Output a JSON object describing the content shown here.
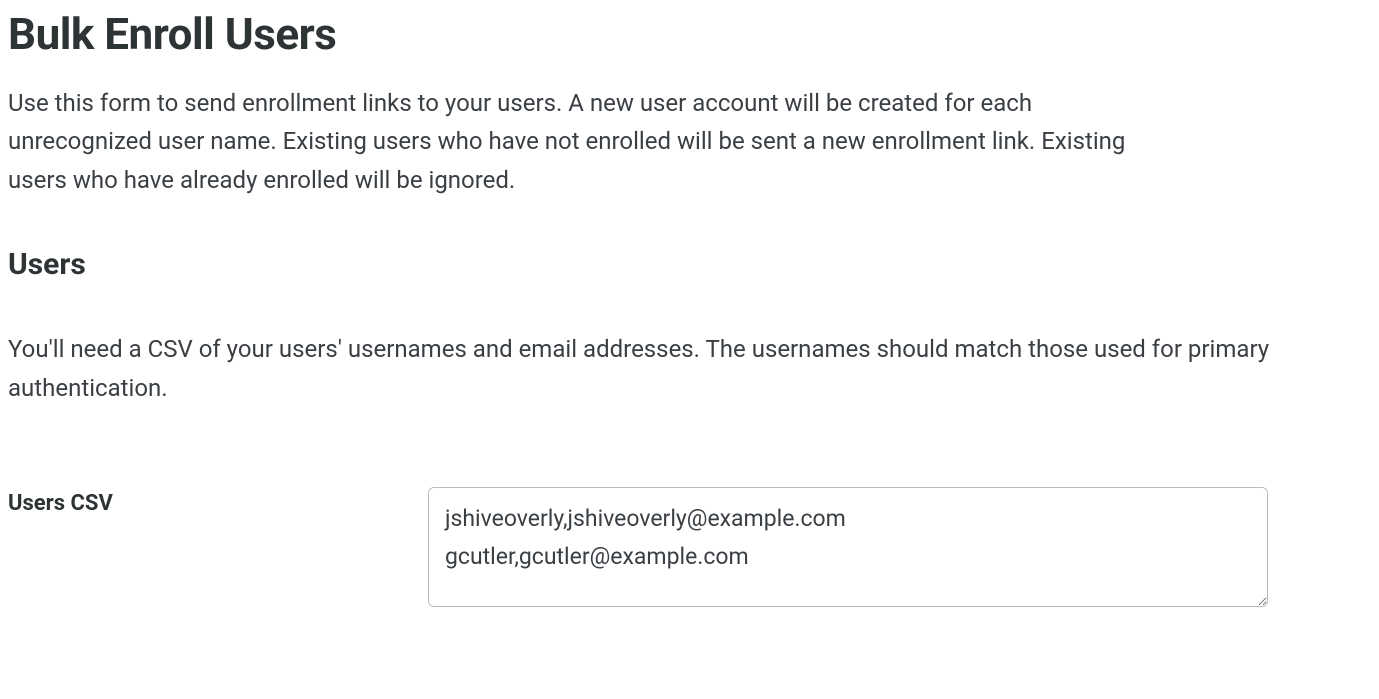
{
  "page": {
    "title": "Bulk Enroll Users",
    "intro": "Use this form to send enrollment links to your users. A new user account will be created for each unrecognized user name. Existing users who have not enrolled will be sent a new enrollment link. Existing users who have already enrolled will be ignored."
  },
  "users_section": {
    "heading": "Users",
    "description": "You'll need a CSV of your users' usernames and email addresses. The usernames should match those used for primary authentication."
  },
  "form": {
    "csv_label": "Users CSV",
    "csv_value": "jshiveoverly,jshiveoverly@example.com\ngcutler,gcutler@example.com\n"
  }
}
